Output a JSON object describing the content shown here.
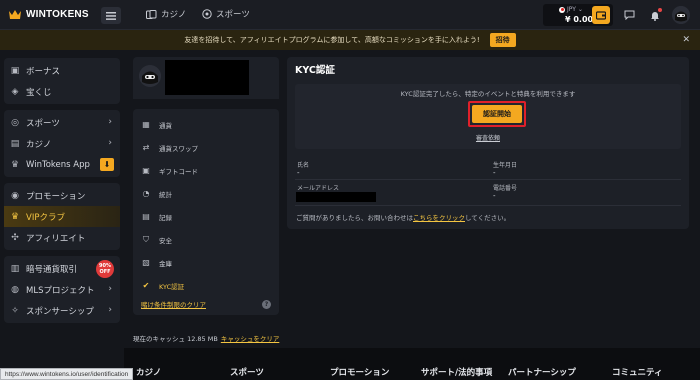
{
  "brand": {
    "name": "WINTOKENS",
    "accent": "#f4a820"
  },
  "topnav": {
    "items": [
      {
        "label": "カジノ",
        "icon": "casino-icon"
      },
      {
        "label": "スポーツ",
        "icon": "sports-icon"
      }
    ],
    "wallet": {
      "currency": "JPY",
      "balance": "¥ 0.00"
    }
  },
  "banner": {
    "text": "友達を招待して、アフィリエイトプログラムに参加して、高額なコミッションを手に入れよう!",
    "button": "招待"
  },
  "sidebar": {
    "groups": [
      [
        {
          "label": "ボーナス",
          "icon": "gift-icon"
        },
        {
          "label": "宝くじ",
          "icon": "lottery-icon"
        }
      ],
      [
        {
          "label": "スポーツ",
          "icon": "sports-icon",
          "chevron": "›"
        },
        {
          "label": "カジノ",
          "icon": "cards-icon",
          "chevron": "›"
        },
        {
          "label": "WinTokens App",
          "icon": "app-icon"
        }
      ],
      [
        {
          "label": "プロモーション",
          "icon": "promotion-icon"
        },
        {
          "label": "VIPクラブ",
          "icon": "crown-icon"
        },
        {
          "label": "アフィリエイト",
          "icon": "affiliate-icon"
        }
      ],
      [
        {
          "label": "暗号通貨取引",
          "icon": "chart-icon",
          "badge_line1": "90%",
          "badge_line2": "OFF"
        },
        {
          "label": "MLSプロジェクト",
          "icon": "mls-icon",
          "chevron": "›"
        },
        {
          "label": "スポンサーシップ",
          "icon": "sponsor-icon",
          "chevron": "›"
        }
      ]
    ]
  },
  "account_menu": {
    "items": [
      {
        "label": "通貨",
        "icon": "currency-icon"
      },
      {
        "label": "通貨スワップ",
        "icon": "swap-icon"
      },
      {
        "label": "ギフトコード",
        "icon": "giftcode-icon"
      },
      {
        "label": "統計",
        "icon": "stats-icon"
      },
      {
        "label": "記録",
        "icon": "records-icon"
      },
      {
        "label": "安全",
        "icon": "shield-icon"
      },
      {
        "label": "金庫",
        "icon": "vault-icon"
      },
      {
        "label": "KYC認証",
        "icon": "kyc-icon"
      }
    ],
    "clear_link": "賭け条件制限のクリア",
    "cache_label": "現在のキャッシュ 12.85 MB",
    "cache_link": "キャッシュをクリア"
  },
  "kyc": {
    "title": "KYC認証",
    "description": "KYC認証完了したら、特定のイベントと特典を利用できます",
    "start_button": "認証開始",
    "review_link": "審査依頼",
    "fields": {
      "name_label": "氏名",
      "name_value": "-",
      "birth_label": "生年月日",
      "birth_value": "-",
      "email_label": "メールアドレス",
      "phone_label": "電話番号",
      "phone_value": "-"
    },
    "help_text": "ご質問がありましたら、お問い合わせは",
    "help_link": "こちらをクリック",
    "help_suffix": "してください。"
  },
  "footer": {
    "items": [
      "カジノ",
      "スポーツ",
      "プロモーション",
      "サポート/法的事項",
      "パートナーシップ",
      "コミュニティ"
    ]
  },
  "statusbar": "https://www.wintokens.io/user/identification"
}
